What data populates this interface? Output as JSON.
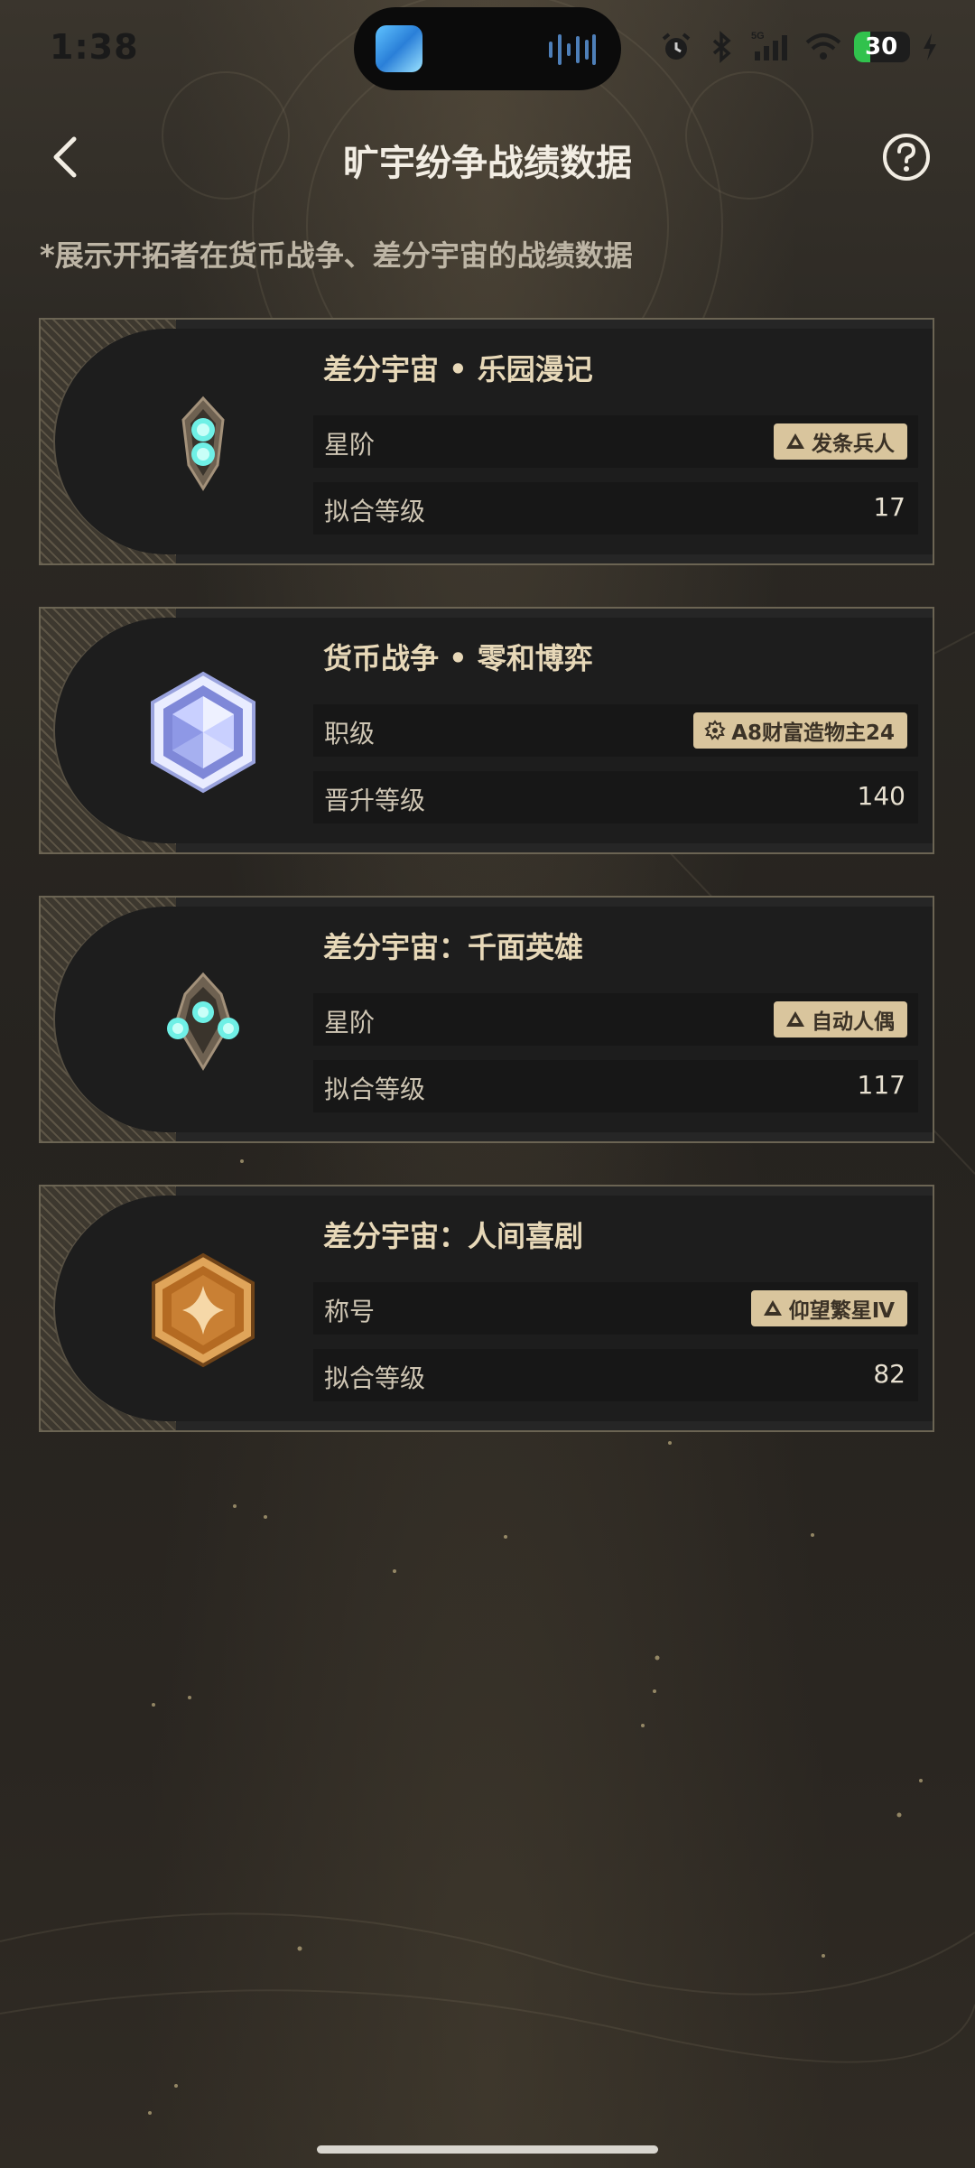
{
  "status_bar": {
    "time": "1:38",
    "network": "5G",
    "battery_level": "30",
    "icons": [
      "alarm-icon",
      "bluetooth-icon",
      "signal-icon",
      "wifi-icon",
      "battery-icon",
      "charging-icon"
    ]
  },
  "header": {
    "title": "旷宇纷争战绩数据",
    "back_icon": "chevron-left-icon",
    "help_icon": "question-icon"
  },
  "subtitle": "*展示开拓者在货币战争、差分宇宙的战绩数据",
  "cards": [
    {
      "title": "差分宇宙 • 乐园漫记",
      "badge_icon": "twin-orb-emblem-icon",
      "row1_label": "星阶",
      "row1_tag": "发条兵人",
      "row1_tag_icon": "rank-peak-icon",
      "row2_label": "拟合等级",
      "row2_value": "17"
    },
    {
      "title": "货币战争 • 零和博弈",
      "badge_icon": "crystal-hexagon-icon",
      "row1_label": "职级",
      "row1_tag": "A8财富造物主24",
      "row1_tag_icon": "rank-gear-icon",
      "row2_label": "晋升等级",
      "row2_value": "140"
    },
    {
      "title": "差分宇宙：千面英雄",
      "badge_icon": "triple-orb-emblem-icon",
      "row1_label": "星阶",
      "row1_tag": "自动人偶",
      "row1_tag_icon": "rank-peak-icon",
      "row2_label": "拟合等级",
      "row2_value": "117"
    },
    {
      "title": "差分宇宙：人间喜剧",
      "badge_icon": "bronze-hexagon-icon",
      "row1_label": "称号",
      "row1_tag": "仰望繁星Ⅳ",
      "row1_tag_icon": "rank-peak-icon",
      "row2_label": "拟合等级",
      "row2_value": "82"
    }
  ],
  "colors": {
    "accent_gold": "#d9c59d",
    "title_gold": "#e7d8b8",
    "orb_cyan": "#6ff0e6",
    "bronze": "#c8802f",
    "battery_green": "#31c24d"
  }
}
